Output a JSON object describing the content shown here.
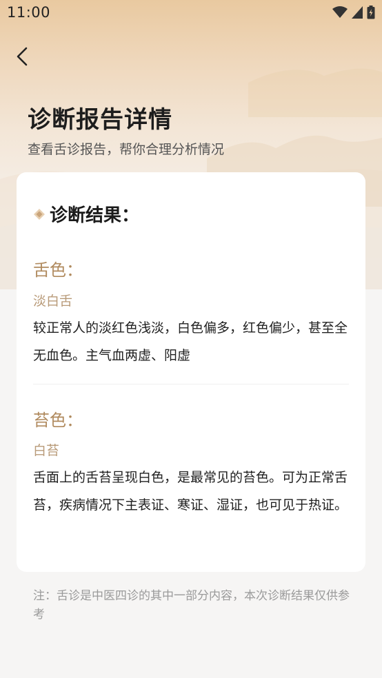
{
  "status_bar": {
    "time": "11:00"
  },
  "header": {
    "title": "诊断报告详情",
    "subtitle": "查看舌诊报告，帮你合理分析情况"
  },
  "card": {
    "section_title": "诊断结果：",
    "tongue_color": {
      "label": "舌色：",
      "value": "淡白舌",
      "description": "较正常人的淡红色浅淡，白色偏多，红色偏少，甚至全无血色。主气血两虚、阳虚"
    },
    "coating_color": {
      "label": "苔色：",
      "value": "白苔",
      "description": "舌面上的舌苔呈现白色，是最常见的苔色。可为正常舌苔，疾病情况下主表证、寒证、湿证，也可见于热证。"
    }
  },
  "note": "注：舌诊是中医四诊的其中一部分内容，本次诊断结果仅供参考",
  "colors": {
    "accent": "#b08a5e",
    "accent_light": "#b89a78",
    "header_gradient_top": "#e9c9a0",
    "background": "#f6f5f4"
  },
  "icons": [
    "wifi-icon",
    "signal-icon",
    "battery-icon",
    "back-arrow-icon",
    "diamond-icon"
  ]
}
